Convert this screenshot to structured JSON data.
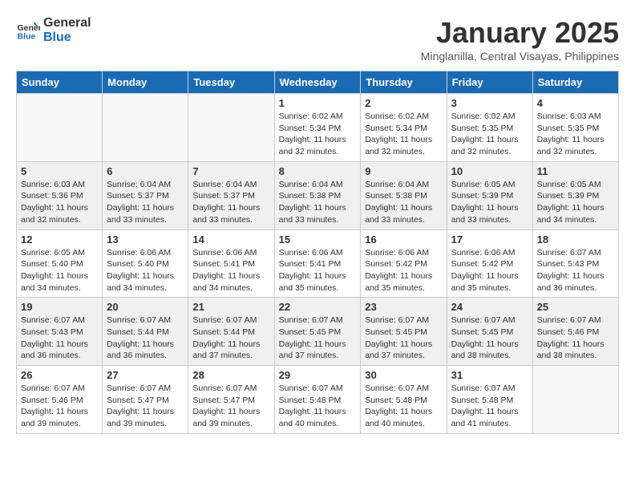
{
  "header": {
    "logo_line1": "General",
    "logo_line2": "Blue",
    "month": "January 2025",
    "location": "Minglanilla, Central Visayas, Philippines"
  },
  "days_of_week": [
    "Sunday",
    "Monday",
    "Tuesday",
    "Wednesday",
    "Thursday",
    "Friday",
    "Saturday"
  ],
  "weeks": [
    [
      {
        "day": "",
        "info": ""
      },
      {
        "day": "",
        "info": ""
      },
      {
        "day": "",
        "info": ""
      },
      {
        "day": "1",
        "info": "Sunrise: 6:02 AM\nSunset: 5:34 PM\nDaylight: 11 hours\nand 32 minutes."
      },
      {
        "day": "2",
        "info": "Sunrise: 6:02 AM\nSunset: 5:34 PM\nDaylight: 11 hours\nand 32 minutes."
      },
      {
        "day": "3",
        "info": "Sunrise: 6:02 AM\nSunset: 5:35 PM\nDaylight: 11 hours\nand 32 minutes."
      },
      {
        "day": "4",
        "info": "Sunrise: 6:03 AM\nSunset: 5:35 PM\nDaylight: 11 hours\nand 32 minutes."
      }
    ],
    [
      {
        "day": "5",
        "info": "Sunrise: 6:03 AM\nSunset: 5:36 PM\nDaylight: 11 hours\nand 32 minutes."
      },
      {
        "day": "6",
        "info": "Sunrise: 6:04 AM\nSunset: 5:37 PM\nDaylight: 11 hours\nand 33 minutes."
      },
      {
        "day": "7",
        "info": "Sunrise: 6:04 AM\nSunset: 5:37 PM\nDaylight: 11 hours\nand 33 minutes."
      },
      {
        "day": "8",
        "info": "Sunrise: 6:04 AM\nSunset: 5:38 PM\nDaylight: 11 hours\nand 33 minutes."
      },
      {
        "day": "9",
        "info": "Sunrise: 6:04 AM\nSunset: 5:38 PM\nDaylight: 11 hours\nand 33 minutes."
      },
      {
        "day": "10",
        "info": "Sunrise: 6:05 AM\nSunset: 5:39 PM\nDaylight: 11 hours\nand 33 minutes."
      },
      {
        "day": "11",
        "info": "Sunrise: 6:05 AM\nSunset: 5:39 PM\nDaylight: 11 hours\nand 34 minutes."
      }
    ],
    [
      {
        "day": "12",
        "info": "Sunrise: 6:05 AM\nSunset: 5:40 PM\nDaylight: 11 hours\nand 34 minutes."
      },
      {
        "day": "13",
        "info": "Sunrise: 6:06 AM\nSunset: 5:40 PM\nDaylight: 11 hours\nand 34 minutes."
      },
      {
        "day": "14",
        "info": "Sunrise: 6:06 AM\nSunset: 5:41 PM\nDaylight: 11 hours\nand 34 minutes."
      },
      {
        "day": "15",
        "info": "Sunrise: 6:06 AM\nSunset: 5:41 PM\nDaylight: 11 hours\nand 35 minutes."
      },
      {
        "day": "16",
        "info": "Sunrise: 6:06 AM\nSunset: 5:42 PM\nDaylight: 11 hours\nand 35 minutes."
      },
      {
        "day": "17",
        "info": "Sunrise: 6:06 AM\nSunset: 5:42 PM\nDaylight: 11 hours\nand 35 minutes."
      },
      {
        "day": "18",
        "info": "Sunrise: 6:07 AM\nSunset: 5:43 PM\nDaylight: 11 hours\nand 36 minutes."
      }
    ],
    [
      {
        "day": "19",
        "info": "Sunrise: 6:07 AM\nSunset: 5:43 PM\nDaylight: 11 hours\nand 36 minutes."
      },
      {
        "day": "20",
        "info": "Sunrise: 6:07 AM\nSunset: 5:44 PM\nDaylight: 11 hours\nand 36 minutes."
      },
      {
        "day": "21",
        "info": "Sunrise: 6:07 AM\nSunset: 5:44 PM\nDaylight: 11 hours\nand 37 minutes."
      },
      {
        "day": "22",
        "info": "Sunrise: 6:07 AM\nSunset: 5:45 PM\nDaylight: 11 hours\nand 37 minutes."
      },
      {
        "day": "23",
        "info": "Sunrise: 6:07 AM\nSunset: 5:45 PM\nDaylight: 11 hours\nand 37 minutes."
      },
      {
        "day": "24",
        "info": "Sunrise: 6:07 AM\nSunset: 5:45 PM\nDaylight: 11 hours\nand 38 minutes."
      },
      {
        "day": "25",
        "info": "Sunrise: 6:07 AM\nSunset: 5:46 PM\nDaylight: 11 hours\nand 38 minutes."
      }
    ],
    [
      {
        "day": "26",
        "info": "Sunrise: 6:07 AM\nSunset: 5:46 PM\nDaylight: 11 hours\nand 39 minutes."
      },
      {
        "day": "27",
        "info": "Sunrise: 6:07 AM\nSunset: 5:47 PM\nDaylight: 11 hours\nand 39 minutes."
      },
      {
        "day": "28",
        "info": "Sunrise: 6:07 AM\nSunset: 5:47 PM\nDaylight: 11 hours\nand 39 minutes."
      },
      {
        "day": "29",
        "info": "Sunrise: 6:07 AM\nSunset: 5:48 PM\nDaylight: 11 hours\nand 40 minutes."
      },
      {
        "day": "30",
        "info": "Sunrise: 6:07 AM\nSunset: 5:48 PM\nDaylight: 11 hours\nand 40 minutes."
      },
      {
        "day": "31",
        "info": "Sunrise: 6:07 AM\nSunset: 5:48 PM\nDaylight: 11 hours\nand 41 minutes."
      },
      {
        "day": "",
        "info": ""
      }
    ]
  ]
}
